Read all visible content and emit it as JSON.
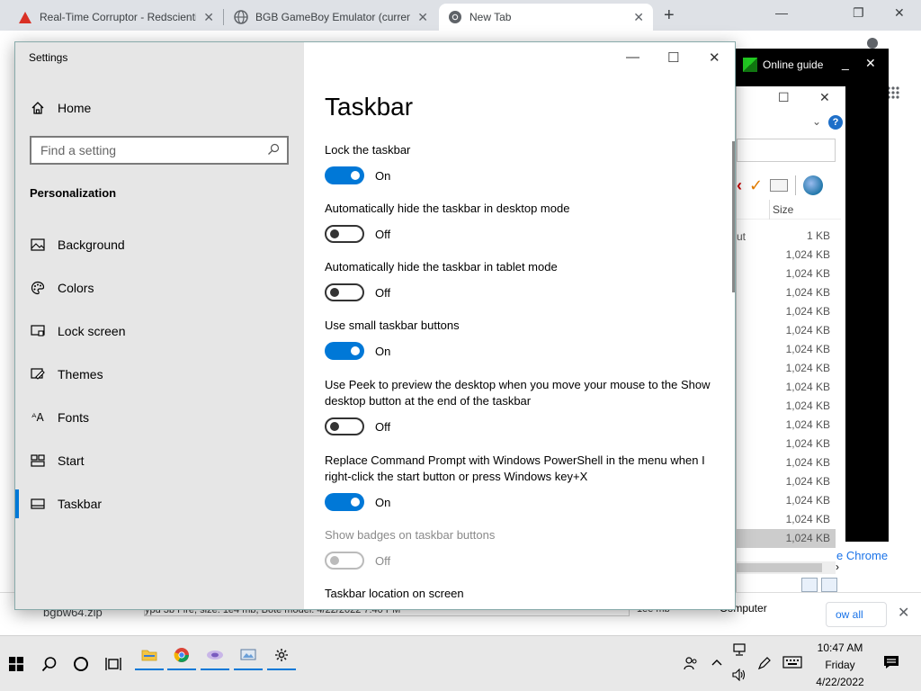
{
  "chrome": {
    "tabs": [
      {
        "title": "Real-Time Corruptor - Redscienti",
        "icon": "warning-triangle-icon"
      },
      {
        "title": "BGB GameBoy Emulator (current",
        "icon": "globe-icon"
      },
      {
        "title": "New Tab",
        "icon": "chrome-icon"
      }
    ],
    "new_tab_glyph": "+",
    "win_controls": {
      "min": "—",
      "max": "❐",
      "close": "✕"
    },
    "promo_link": "e Chrome"
  },
  "dark_app": {
    "title": "Online guide",
    "min": "_",
    "close": "✕"
  },
  "explorer": {
    "controls": {
      "max": "☐",
      "close": "✕"
    },
    "help": "?",
    "column_size": "Size",
    "partial_row_label": "ut",
    "rows": [
      "1 KB",
      "1,024 KB",
      "1,024 KB",
      "1,024 KB",
      "1,024 KB",
      "1,024 KB",
      "1,024 KB",
      "1,024 KB",
      "1,024 KB",
      "1,024 KB",
      "1,024 KB",
      "1,024 KB",
      "1,024 KB",
      "1,024 KB",
      "1,024 KB",
      "1,024 KB",
      "1,024 KB"
    ],
    "scroll_arrow": "›"
  },
  "downloads": {
    "file": "bgbw64.zip",
    "fragment_text": "ypd 3b Fire, size: 1e4 mb, Bote model: 4/22/2022 7:40 PM",
    "fragment_size": "1ee mb",
    "computer_label": "Computer",
    "show_all": "ow all",
    "close": "✕"
  },
  "settings": {
    "window_title": "Settings",
    "controls": {
      "min": "—",
      "max": "☐",
      "close": "✕"
    },
    "home": "Home",
    "search_placeholder": "Find a setting",
    "section": "Personalization",
    "nav": [
      {
        "label": "Background",
        "icon": "picture-icon"
      },
      {
        "label": "Colors",
        "icon": "palette-icon"
      },
      {
        "label": "Lock screen",
        "icon": "lock-screen-icon"
      },
      {
        "label": "Themes",
        "icon": "themes-icon"
      },
      {
        "label": "Fonts",
        "icon": "fonts-icon"
      },
      {
        "label": "Start",
        "icon": "start-icon"
      },
      {
        "label": "Taskbar",
        "icon": "taskbar-icon",
        "active": true
      }
    ],
    "page_title": "Taskbar",
    "options": [
      {
        "label": "Lock the taskbar",
        "state": "On",
        "on": true
      },
      {
        "label": "Automatically hide the taskbar in desktop mode",
        "state": "Off",
        "on": false
      },
      {
        "label": "Automatically hide the taskbar in tablet mode",
        "state": "Off",
        "on": false
      },
      {
        "label": "Use small taskbar buttons",
        "state": "On",
        "on": true
      },
      {
        "label": "Use Peek to preview the desktop when you move your mouse to the Show desktop button at the end of the taskbar",
        "state": "Off",
        "on": false
      },
      {
        "label": "Replace Command Prompt with Windows PowerShell in the menu when I right-click the start button or press Windows key+X",
        "state": "On",
        "on": true
      },
      {
        "label": "Show badges on taskbar buttons",
        "state": "Off",
        "on": false,
        "disabled": true
      }
    ],
    "location_heading": "Taskbar location on screen",
    "accent": "#0078d7"
  },
  "taskbar": {
    "time": "10:47 AM",
    "day": "Friday",
    "date": "4/22/2022",
    "apps": [
      "file-explorer-icon",
      "chrome-icon",
      "media-app-icon",
      "network-app-icon",
      "settings-gear-icon"
    ]
  }
}
